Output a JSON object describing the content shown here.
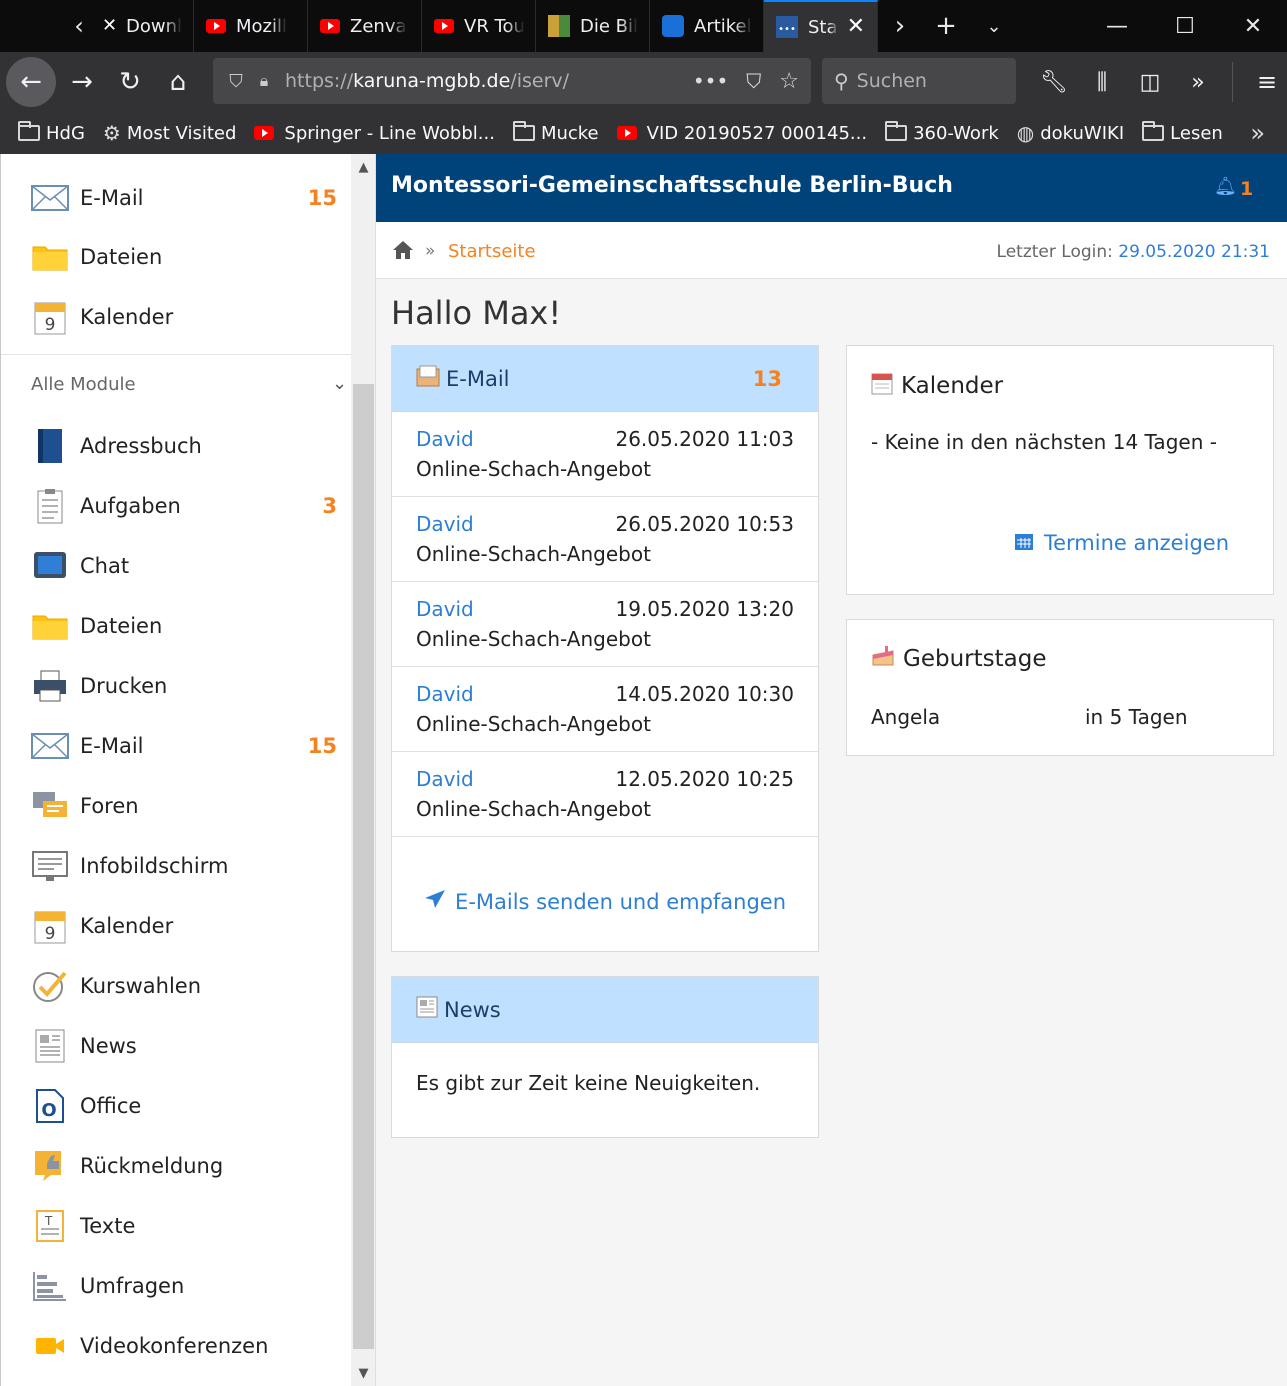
{
  "browser": {
    "tabs": [
      {
        "label": "Downl",
        "icon": "x-icon"
      },
      {
        "label": "Mozill",
        "icon": "youtube-icon"
      },
      {
        "label": "Zenva",
        "icon": "youtube-icon"
      },
      {
        "label": "VR Tou",
        "icon": "youtube-icon"
      },
      {
        "label": "Die Bil",
        "icon": "image-icon"
      },
      {
        "label": "Artikel",
        "icon": "article-icon"
      },
      {
        "label": "Sta",
        "icon": "iserv-icon",
        "active": true
      }
    ],
    "url_prefix": "https://",
    "url_domain": "karuna-mgbb.de",
    "url_path": "/iserv/",
    "search_placeholder": "Suchen",
    "bookmarks": [
      {
        "label": "HdG",
        "icon": "folder-icon"
      },
      {
        "label": "Most Visited",
        "icon": "gear-icon"
      },
      {
        "label": "Springer - Line Wobbl...",
        "icon": "youtube-icon"
      },
      {
        "label": "Mucke",
        "icon": "folder-icon"
      },
      {
        "label": "VID 20190527 000145...",
        "icon": "youtube-icon"
      },
      {
        "label": "360-Work",
        "icon": "folder-icon"
      },
      {
        "label": "dokuWIKI",
        "icon": "globe-icon"
      },
      {
        "label": "Lesen",
        "icon": "folder-icon"
      }
    ]
  },
  "sidebar": {
    "favorites": [
      {
        "label": "E-Mail",
        "badge": "15",
        "icon": "mail-icon"
      },
      {
        "label": "Dateien",
        "badge": "",
        "icon": "folder-icon"
      },
      {
        "label": "Kalender",
        "badge": "",
        "icon": "calendar-icon"
      }
    ],
    "all_modules_label": "Alle Module",
    "modules": [
      {
        "label": "Adressbuch",
        "badge": "",
        "icon": "addressbook-icon"
      },
      {
        "label": "Aufgaben",
        "badge": "3",
        "icon": "tasks-icon"
      },
      {
        "label": "Chat",
        "badge": "",
        "icon": "chat-icon"
      },
      {
        "label": "Dateien",
        "badge": "",
        "icon": "folder-icon"
      },
      {
        "label": "Drucken",
        "badge": "",
        "icon": "printer-icon"
      },
      {
        "label": "E-Mail",
        "badge": "15",
        "icon": "mail-icon"
      },
      {
        "label": "Foren",
        "badge": "",
        "icon": "forum-icon"
      },
      {
        "label": "Infobildschirm",
        "badge": "",
        "icon": "infoscreen-icon"
      },
      {
        "label": "Kalender",
        "badge": "",
        "icon": "calendar-icon"
      },
      {
        "label": "Kurswahlen",
        "badge": "",
        "icon": "checkmark-icon"
      },
      {
        "label": "News",
        "badge": "",
        "icon": "news-icon"
      },
      {
        "label": "Office",
        "badge": "",
        "icon": "office-icon"
      },
      {
        "label": "Rückmeldung",
        "badge": "",
        "icon": "feedback-icon"
      },
      {
        "label": "Texte",
        "badge": "",
        "icon": "text-icon"
      },
      {
        "label": "Umfragen",
        "badge": "",
        "icon": "survey-icon"
      },
      {
        "label": "Videokonferenzen",
        "badge": "",
        "icon": "video-icon"
      }
    ]
  },
  "header": {
    "title": "Montessori-Gemeinschaftsschule Berlin-Buch",
    "notifications": "1"
  },
  "breadcrumb": {
    "current": "Startseite",
    "separator": "»",
    "last_login_label": "Letzter Login:",
    "last_login_value": "29.05.2020 21:31"
  },
  "greeting": "Hallo Max!",
  "email_card": {
    "title": "E-Mail",
    "count": "13",
    "messages": [
      {
        "from": "David",
        "date": "26.05.2020 11:03",
        "subject": "Online-Schach-Angebot"
      },
      {
        "from": "David",
        "date": "26.05.2020 10:53",
        "subject": "Online-Schach-Angebot"
      },
      {
        "from": "David",
        "date": "19.05.2020 13:20",
        "subject": "Online-Schach-Angebot"
      },
      {
        "from": "David",
        "date": "14.05.2020 10:30",
        "subject": "Online-Schach-Angebot"
      },
      {
        "from": "David",
        "date": "12.05.2020 10:25",
        "subject": "Online-Schach-Angebot"
      }
    ],
    "action": "E-Mails senden und empfangen"
  },
  "news_card": {
    "title": "News",
    "empty": "Es gibt zur Zeit keine Neuigkeiten."
  },
  "calendar_card": {
    "title": "Kalender",
    "empty": "- Keine in den nächsten 14 Tagen -",
    "action": "Termine anzeigen"
  },
  "birthday_card": {
    "title": "Geburtstage",
    "entries": [
      {
        "name": "Angela",
        "when": "in 5 Tagen"
      }
    ]
  },
  "colors": {
    "header_bg": "#00427a",
    "accent_orange": "#f58220",
    "link_blue": "#2d7fd5",
    "card_header_bg": "#bfe0ff"
  }
}
